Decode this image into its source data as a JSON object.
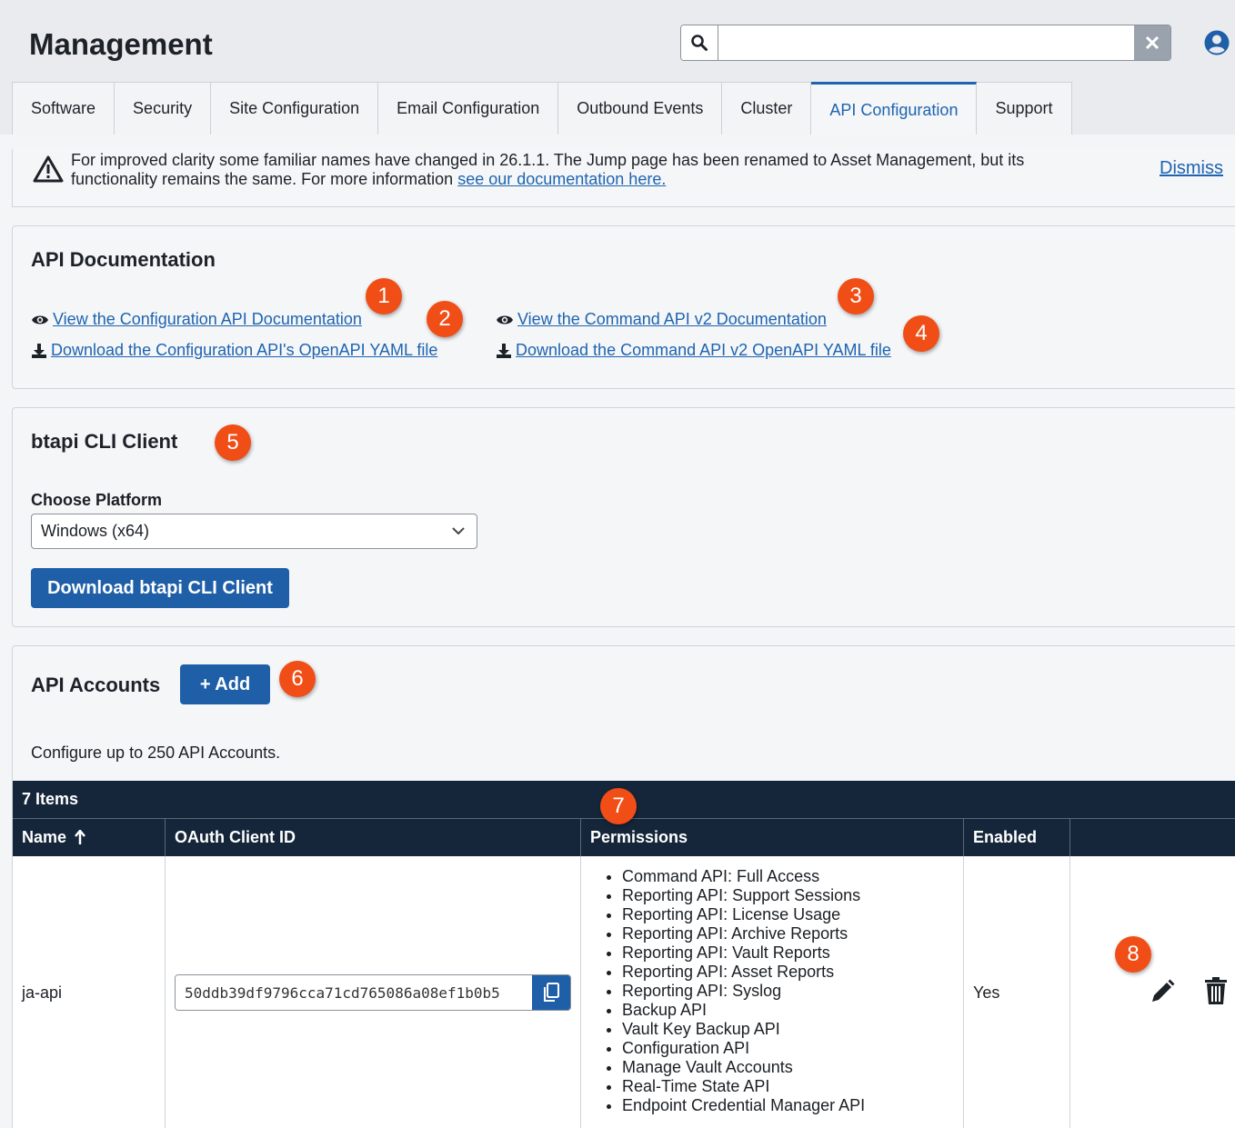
{
  "header": {
    "title": "Management",
    "search_placeholder": ""
  },
  "tabs": [
    {
      "label": "Software"
    },
    {
      "label": "Security"
    },
    {
      "label": "Site Configuration"
    },
    {
      "label": "Email Configuration"
    },
    {
      "label": "Outbound Events"
    },
    {
      "label": "Cluster"
    },
    {
      "label": "API Configuration",
      "active": true
    },
    {
      "label": "Support"
    }
  ],
  "banner": {
    "text": "For improved clarity some familiar names have changed in 26.1.1. The Jump page has been renamed to Asset Management, but its functionality remains the same. For more information",
    "link": "see our documentation here.",
    "dismiss": "Dismiss"
  },
  "api_docs": {
    "title": "API Documentation",
    "view_config": "View the Configuration API Documentation",
    "download_config": "Download the Configuration API's OpenAPI YAML file",
    "view_command": "View the Command API v2 Documentation",
    "download_command": "Download the Command API v2 OpenAPI YAML file"
  },
  "cli": {
    "title": "btapi CLI Client",
    "platform_label": "Choose Platform",
    "platform_value": "Windows (x64)",
    "download_button": "Download btapi CLI Client"
  },
  "accounts": {
    "title": "API Accounts",
    "add_button": "+ Add",
    "helper": "Configure up to 250 API Accounts.",
    "items_count": "7 Items",
    "columns": [
      "Name",
      "OAuth Client ID",
      "Permissions",
      "Enabled",
      ""
    ],
    "rows": [
      {
        "name": "ja-api",
        "client_id": "50ddb39df9796cca71cd765086a08ef1b0b5",
        "permissions": [
          "Command API: Full Access",
          "Reporting API: Support Sessions",
          "Reporting API: License Usage",
          "Reporting API: Archive Reports",
          "Reporting API: Vault Reports",
          "Reporting API: Asset Reports",
          "Reporting API: Syslog",
          "Backup API",
          "Vault Key Backup API",
          "Configuration API",
          "Manage Vault Accounts",
          "Real-Time State API",
          "Endpoint Credential Manager API"
        ],
        "enabled": "Yes"
      }
    ]
  },
  "callouts": [
    "1",
    "2",
    "3",
    "4",
    "5",
    "6",
    "7",
    "8"
  ],
  "colors": {
    "accent": "#1e64b0",
    "primary_button": "#1f5fa8",
    "table_header": "#15263a",
    "callout": "#f04e16"
  }
}
